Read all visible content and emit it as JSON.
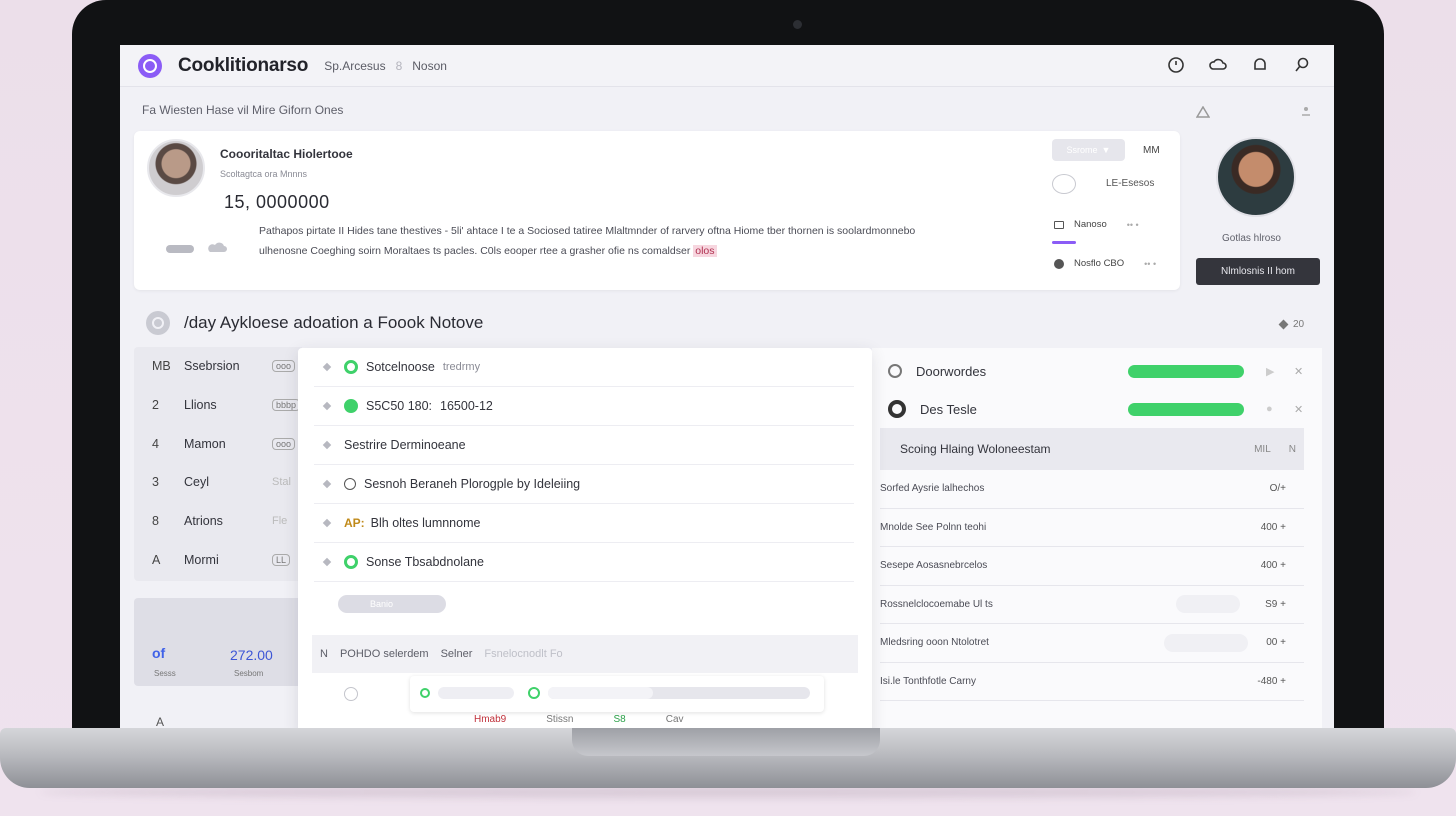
{
  "app": {
    "title": "Cooklitionarso",
    "nav": [
      "Sp.Arcesus",
      "8",
      "Noson"
    ]
  },
  "subtitle": "Fa Wiesten Hase vil Mire Giforn Ones",
  "profile": {
    "name": "Coooritaltac Hiolertooe",
    "handle": "Scoltagtca ora Mnnns",
    "amount": "15, 0000000",
    "desc_line1": "Pathapos pirtate II Hides tane thestives - 5li' ahtace I te a Sociosed tatiree Mlaltmnder of rarvery oftna Hiome tber thornen is soolardmonnebo",
    "desc_line2": "ulhenosne Coeghing soirn Moraltaes ts pacles. C0ls eooper rtee a grasher ofie ns comaldser",
    "desc_highlight": "olos",
    "button": "Ssrome",
    "mm": "MM",
    "le_label": "LE-Esesos",
    "items": [
      {
        "label": "Nanoso",
        "dots": "•• •"
      },
      {
        "label": "Nosflo CBO",
        "dots": "•• •"
      }
    ]
  },
  "right_profile": {
    "name": "Gotlas hlroso",
    "button": "Nlmlosnis II hom"
  },
  "section": {
    "title": "/day Aykloese adoation a Foook Notove",
    "meta": "20"
  },
  "left_list": [
    {
      "num": "MB",
      "label": "Ssebrsion",
      "tag": "ooo"
    },
    {
      "num": "2",
      "label": "Llions",
      "tag": "bbbp"
    },
    {
      "num": "4",
      "label": "Mamon",
      "tag": "ooo"
    },
    {
      "num": "3",
      "label": "Ceyl",
      "tag": "Stal"
    },
    {
      "num": "8",
      "label": "Atrions",
      "tag": "Fle"
    },
    {
      "num": "A",
      "label": "Mormi",
      "tag": "LL"
    }
  ],
  "left_stats": {
    "icon": "of",
    "value": "272.00",
    "label1": "Sesss",
    "label2": "Sesbom"
  },
  "left_footer": "A",
  "middle": {
    "rows": [
      {
        "label": "Sotcelnoose",
        "sub": "tredrmy",
        "dot": "ring"
      },
      {
        "label": "S5C50 180:",
        "sub": "16500-12",
        "dot": "solid"
      },
      {
        "label": "Sestrire Derminoeane",
        "sub": "",
        "dot": ""
      },
      {
        "label": "Sesnoh Beraneh Plorogple by Ideleiing",
        "sub": "",
        "dot": "search"
      },
      {
        "label": "Blh oltes lumnnome",
        "sub": "",
        "dot": "tag",
        "tag": "AP:"
      },
      {
        "label": "Sonse Tbsabdnolane",
        "sub": "",
        "dot": "ring"
      }
    ],
    "pill": "Banio",
    "footer": [
      "POHDO selerdem",
      "Selner",
      "Fsnelocnodlt Fo"
    ],
    "labels": [
      "Hmab9",
      "Stissn",
      "S8",
      "Cav"
    ]
  },
  "right_panel": {
    "top": [
      {
        "label": "Doorwordes",
        "progress": 1.0
      },
      {
        "label": "Des Tesle",
        "progress": 1.0
      }
    ],
    "table_head": "Scoing Hlaing Woloneestam",
    "table_meta": [
      "MIL",
      "N"
    ],
    "rows": [
      {
        "label": "Sorfed Aysrie lalhechos",
        "value": "O/+"
      },
      {
        "label": "Mnolde See Polnn teohi",
        "value": "400 +"
      },
      {
        "label": "Sesepe Aosasnebrcelos",
        "value": "400 +"
      },
      {
        "label": "Rossnelclocoemabe Ul ts",
        "value": "S9 +"
      },
      {
        "label": "Mledsring ooon Ntolotret",
        "value": "00 +"
      },
      {
        "label": "Isi.le Tonthfotle Carny",
        "value": "-480 +"
      }
    ]
  },
  "colors": {
    "accent": "#8b5cf6",
    "success": "#3fd16a",
    "link": "#3d56d6"
  }
}
